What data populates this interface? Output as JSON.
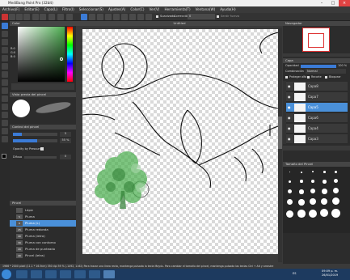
{
  "window": {
    "title": "MediBang Paint Pro (32bit)"
  },
  "menu": [
    "Archivo(F)",
    "Editar(E)",
    "Capa(L)",
    "Filtro(I)",
    "Seleccionar(S)",
    "Ajustes(A)",
    "Color(C)",
    "Ver(V)",
    "Herramienta(T)",
    "Ventana(W)",
    "Ayuda(H)"
  ],
  "toolbar": {
    "smooth_label": "Suavizado",
    "correction_label": "Corrección",
    "correction_value": "0",
    "pressure_label": "Sentir fuerza"
  },
  "color_panel": {
    "title": "Color",
    "r_label": "R:",
    "g_label": "G:",
    "b_label": "B:",
    "r": "0",
    "g": "0",
    "b": "0",
    "accent": "#4caf50"
  },
  "brush_preview": {
    "title": "Vista previa del pincel"
  },
  "brush_control": {
    "title": "Control del pincel",
    "size_value": "5",
    "opacity_value": "55 %",
    "opacity_by_pressure": "Opacity by Pressure",
    "blur_label": "Difuso",
    "blur_value": "0"
  },
  "brush_list": {
    "title": "Pincel",
    "items": [
      {
        "size": "",
        "name": "Lápiz"
      },
      {
        "size": "5",
        "name": "Pluma"
      },
      {
        "size": "8",
        "name": "Pluma (L)"
      },
      {
        "size": "25",
        "name": "Pluma redonda"
      },
      {
        "size": "40",
        "name": "Pluma (letra)"
      },
      {
        "size": "30",
        "name": "Pluma con contorno"
      },
      {
        "size": "20",
        "name": "Pluma de punteado"
      },
      {
        "size": "40",
        "name": "Pincel (letra)"
      }
    ]
  },
  "canvas": {
    "title": "Untitled"
  },
  "navigator": {
    "title": "Navegador"
  },
  "layer_panel": {
    "title": "Capa",
    "opacity_label": "Opacidad",
    "opacity_value": "100 %",
    "blend_label": "Combinación",
    "blend_value": "Normal",
    "protect_alpha": "Proteger alfa",
    "clipping": "Recorte",
    "lock": "Bloquear",
    "layers": [
      {
        "name": "Capa8",
        "selected": false
      },
      {
        "name": "Capa7",
        "selected": false
      },
      {
        "name": "Capa5",
        "selected": true
      },
      {
        "name": "Capa6",
        "selected": false
      },
      {
        "name": "Capa4",
        "selected": false
      },
      {
        "name": "Capa3",
        "selected": false
      }
    ]
  },
  "brush_size_panel": {
    "title": "Tamaño del Pincel"
  },
  "statusbar": {
    "text": "1966 * 2000 pixel (11.1 * 16.9cm) 350 dpi 59 % (-1492, 1162) Para trazar una línea recta, mantenga pulsada la tecla Mayús. Para cambiar el tamaño del pincel, mantenga pulsada las teclas Ctrl + Alt y arrastre"
  },
  "taskbar": {
    "time": "09:09 p. m.",
    "date": "26/01/2019",
    "lang": "ES"
  }
}
